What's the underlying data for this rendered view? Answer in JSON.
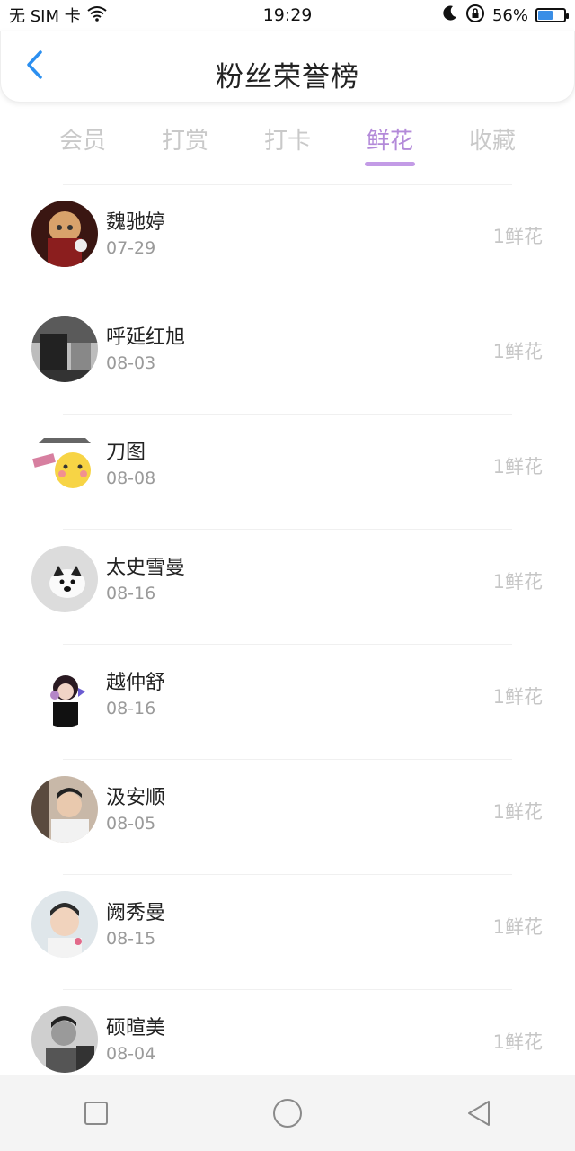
{
  "status": {
    "carrier": "无 SIM 卡",
    "time": "19:29",
    "battery": "56%",
    "battery_level": 0.56
  },
  "header": {
    "title": "粉丝荣誉榜"
  },
  "tabs": [
    {
      "label": "会员",
      "active": false
    },
    {
      "label": "打赏",
      "active": false
    },
    {
      "label": "打卡",
      "active": false
    },
    {
      "label": "鲜花",
      "active": true
    },
    {
      "label": "收藏",
      "active": false
    }
  ],
  "fans": [
    {
      "name": "魏驰婷",
      "date": "07-29",
      "value": "1鲜花"
    },
    {
      "name": "呼延红旭",
      "date": "08-03",
      "value": "1鲜花"
    },
    {
      "name": "刀图",
      "date": "08-08",
      "value": "1鲜花"
    },
    {
      "name": "太史雪曼",
      "date": "08-16",
      "value": "1鲜花"
    },
    {
      "name": "越仲舒",
      "date": "08-16",
      "value": "1鲜花"
    },
    {
      "name": "汲安顺",
      "date": "08-05",
      "value": "1鲜花"
    },
    {
      "name": "阙秀曼",
      "date": "08-15",
      "value": "1鲜花"
    },
    {
      "name": "硕暄美",
      "date": "08-04",
      "value": "1鲜花"
    }
  ]
}
